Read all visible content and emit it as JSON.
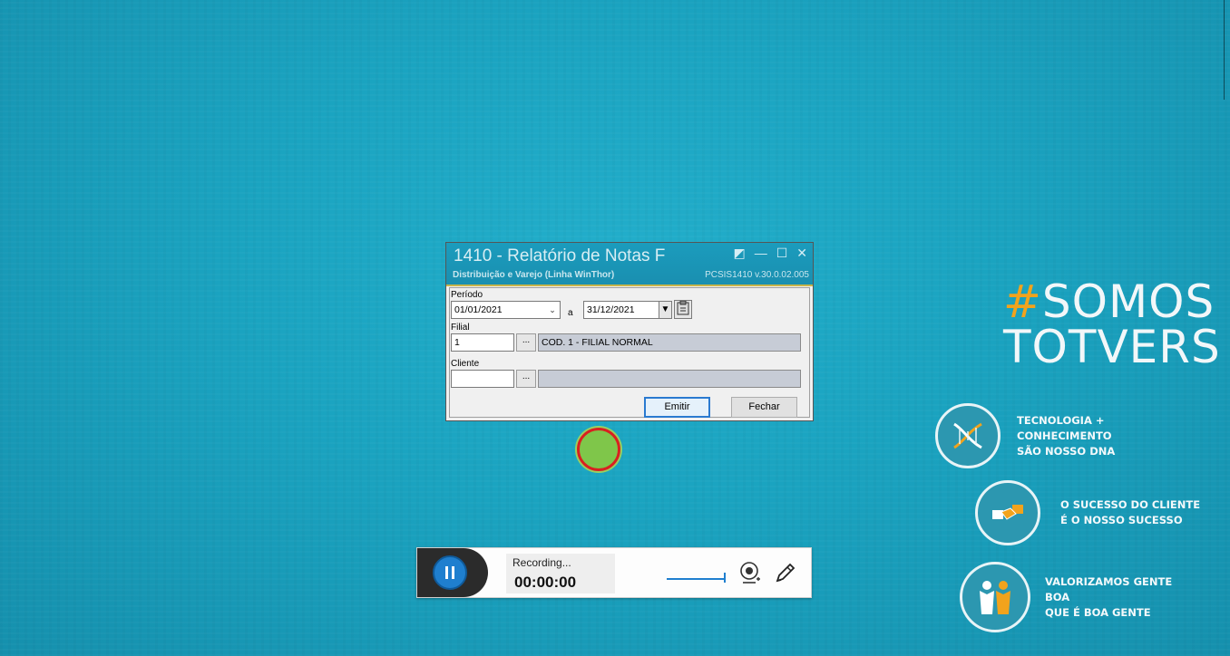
{
  "branding": {
    "hashtag": "#",
    "line1": "SOMOS",
    "line2": "TOTVERS",
    "values": [
      {
        "line1": "TECNOLOGIA + CONHECIMENTO",
        "line2": "SÃO NOSSO DNA",
        "icon": "dna-icon"
      },
      {
        "line1": "O SUCESSO DO CLIENTE",
        "line2": "É O NOSSO SUCESSO",
        "icon": "handshake-icon"
      },
      {
        "line1": "VALORIZAMOS GENTE BOA",
        "line2": "QUE É BOA GENTE",
        "icon": "people-icon"
      }
    ]
  },
  "dialog": {
    "title": "1410 - Relatório de Notas F",
    "subtitle": "Distribuição e Varejo (Linha WinThor)",
    "version": "PCSIS1410  v.30.0.02.005",
    "periodo_label": "Período",
    "date_from": "01/01/2021",
    "date_sep": "a",
    "date_to": "31/12/2021",
    "filial_label": "Filial",
    "filial_code": "1",
    "filial_desc": "COD. 1 - FILIAL NORMAL",
    "cliente_label": "Cliente",
    "cliente_code": "",
    "cliente_desc": "",
    "ellipsis": "...",
    "emitir": "Emitir",
    "fechar": "Fechar"
  },
  "recorder": {
    "status": "Recording...",
    "time": "00:00:00"
  },
  "colors": {
    "background": "#1aa3c0",
    "accent_orange": "#f2a31c",
    "recorder_blue": "#1f7fcf"
  }
}
